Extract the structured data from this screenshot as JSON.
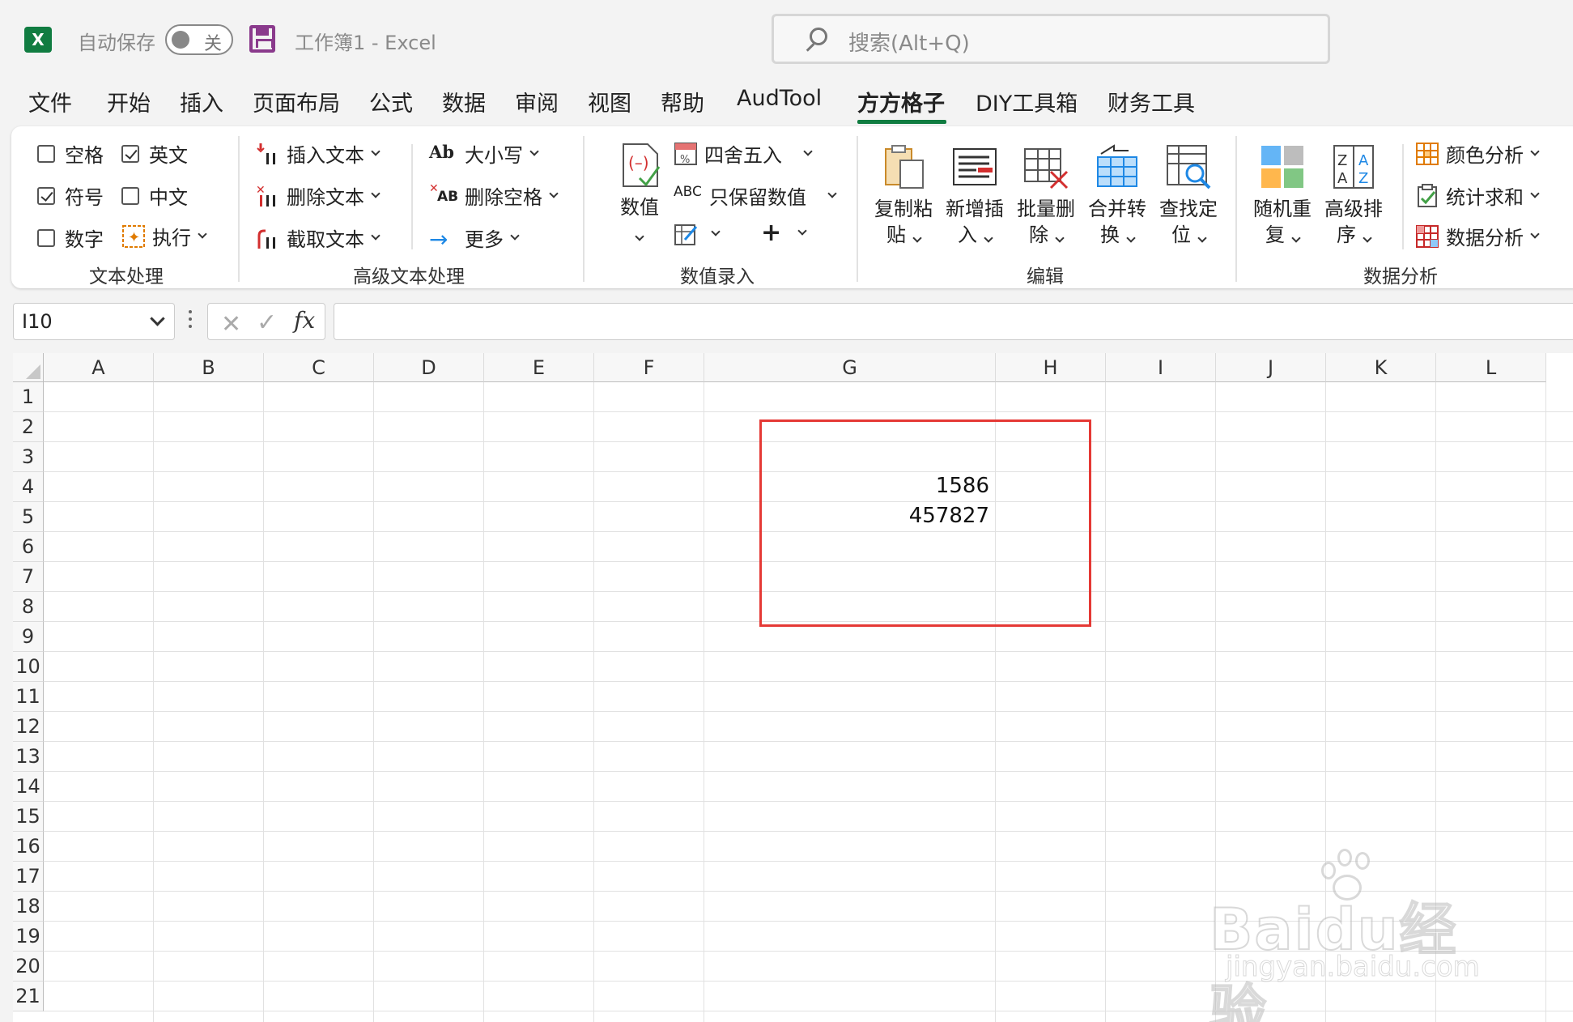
{
  "titlebar": {
    "app_icon": "X",
    "autosave_label": "自动保存",
    "autosave_state": "关",
    "doc_title": "工作簿1  -  Excel",
    "search_placeholder": "搜索(Alt+Q)"
  },
  "menu": [
    "文件",
    "开始",
    "插入",
    "页面布局",
    "公式",
    "数据",
    "审阅",
    "视图",
    "帮助",
    "AudTool",
    "方方格子",
    "DIY工具箱",
    "财务工具"
  ],
  "menu_active": "方方格子",
  "ribbon": {
    "text_group": {
      "label": "文本处理",
      "checkboxes": [
        {
          "label": "空格",
          "checked": false
        },
        {
          "label": "英文",
          "checked": true
        },
        {
          "label": "符号",
          "checked": true
        },
        {
          "label": "中文",
          "checked": false
        },
        {
          "label": "数字",
          "checked": false
        }
      ],
      "execute": "执行"
    },
    "adv_text_group": {
      "label": "高级文本处理",
      "insert_text": "插入文本",
      "delete_text": "删除文本",
      "extract_text": "截取文本",
      "case": "大小写",
      "case_icon": "Ab",
      "delete_space": "删除空格",
      "delete_space_icon": "AB",
      "more": "更多"
    },
    "num_group": {
      "label": "数值录入",
      "value": "数值",
      "round": "四舍五入",
      "keep_value": "只保留数值",
      "keep_value_icon": "ABC",
      "plus": "+"
    },
    "edit_group": {
      "label": "编辑",
      "buttons": [
        {
          "l1": "复制粘",
          "l2": "贴"
        },
        {
          "l1": "新增插",
          "l2": "入"
        },
        {
          "l1": "批量删",
          "l2": "除"
        },
        {
          "l1": "合并转",
          "l2": "换"
        },
        {
          "l1": "查找定",
          "l2": "位"
        }
      ]
    },
    "data_group": {
      "label": "数据分析",
      "buttons": [
        {
          "l1": "随机重",
          "l2": "复"
        },
        {
          "l1": "高级排",
          "l2": "序"
        }
      ],
      "color_analysis": "颜色分析",
      "stat_sum": "统计求和",
      "data_analysis": "数据分析"
    }
  },
  "formula_bar": {
    "name_box": "I10",
    "fx": "fx",
    "cancel_glyph": "✕",
    "enter_glyph": "✓",
    "value": ""
  },
  "columns": [
    "A",
    "B",
    "C",
    "D",
    "E",
    "F",
    "G",
    "H",
    "I",
    "J",
    "K",
    "L"
  ],
  "rows": [
    "1",
    "2",
    "3",
    "4",
    "5",
    "6",
    "7",
    "8",
    "9",
    "10",
    "11",
    "12",
    "13",
    "14",
    "15",
    "16",
    "17",
    "18",
    "19",
    "20",
    "21"
  ],
  "cells": [
    {
      "ref": "G4",
      "value": "1586"
    },
    {
      "ref": "G5",
      "value": "457827"
    }
  ],
  "watermark": {
    "brand": "Baidu经验",
    "url": "jingyan.baidu.com"
  },
  "colors": {
    "excel_green": "#107c41",
    "highlight_red": "#e53935",
    "save_purple": "#8a3a8c"
  }
}
